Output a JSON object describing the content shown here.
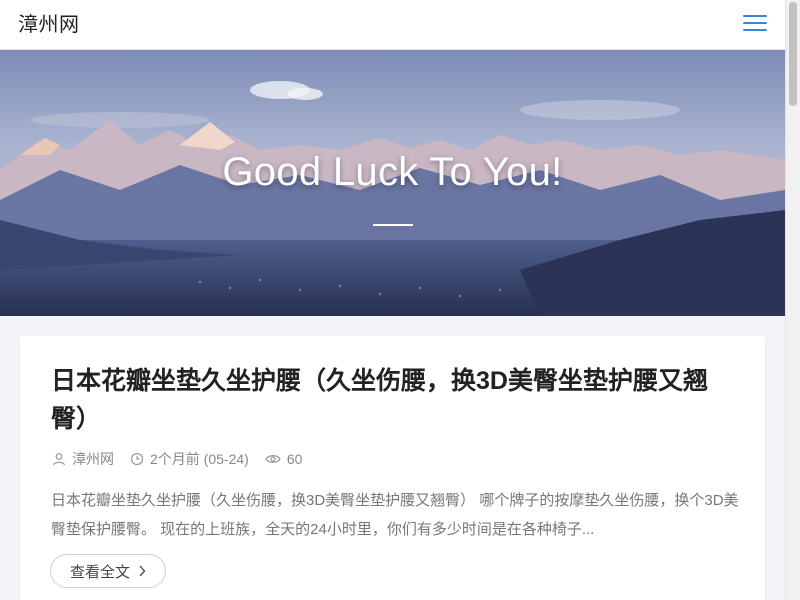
{
  "header": {
    "site_name": "漳州网",
    "menu_icon": "hamburger-menu-icon",
    "accent": "#3a86d4"
  },
  "hero": {
    "title": "Good Luck To You!"
  },
  "article": {
    "title": "日本花瓣坐垫久坐护腰（久坐伤腰，换3D美臀坐垫护腰又翘臀）",
    "author": "漳州网",
    "date": "2个月前 (05-24)",
    "views": "60",
    "excerpt": "日本花瓣坐垫久坐护腰（久坐伤腰，换3D美臀坐垫护腰又翘臀） 哪个牌子的按摩垫久坐伤腰，换个3D美臀垫保护腰臀。 现在的上班族，全天的24小时里，你们有多少时间是在各种椅子...",
    "read_more": "查看全文",
    "icons": [
      "user-icon",
      "clock-icon",
      "eye-icon",
      "chevron-right-icon"
    ]
  }
}
